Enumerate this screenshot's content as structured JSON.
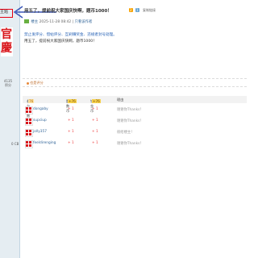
{
  "sidebar": {
    "top_text": "主题",
    "avatar_text": [
      "官",
      "慶"
    ],
    "num_line1": "4135",
    "num_line2": "积分",
    "bottom_text": "0 CB"
  },
  "post": {
    "title": "用五了，提前祝大家国庆快啊，题币1000！",
    "tag_a": "2",
    "tag_b": "1",
    "copy_link": "复制链接",
    "meta_author": "楼主",
    "meta_text": "2025-11-28 08:42",
    "meta_extra": "只看该作者",
    "line1": "禁止发评分、借帖评分、互刷赚奖金、违规者封号处理。",
    "line2": "用五了，提前祝大家国庆快啊，题币1000！"
  },
  "rating": {
    "header": "也是评分",
    "col_user": "参与人数",
    "col_user_count": "76",
    "col_points": "题数币",
    "col_points_total": "+76",
    "col_coins": "钱金币",
    "col_coins_total": "+76",
    "col_reason": "理由",
    "rows": [
      {
        "user": "dongaby",
        "points": "+ 1",
        "coins": "+ 1",
        "reason": "谢谢你Thanks！"
      },
      {
        "user": "supciup",
        "points": "+ 1",
        "coins": "+ 1",
        "reason": "谢谢你Thanks！"
      },
      {
        "user": "jolly357",
        "points": "+ 1",
        "coins": "+ 1",
        "reason": "很给楼主！"
      },
      {
        "user": "feeldirenging",
        "points": "+ 1",
        "coins": "+ 1",
        "reason": "谢谢你Thanks！"
      }
    ]
  },
  "colors": {
    "annotation": "#e60012",
    "arrow": "#3a56b8",
    "link": "#336699"
  }
}
